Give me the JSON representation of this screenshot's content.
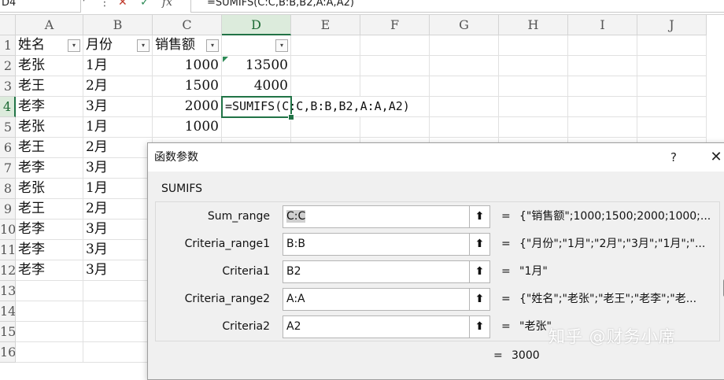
{
  "formula_bar": {
    "name_box": "D4",
    "name_box_arrow": "▾",
    "more_icon": "⋮",
    "cancel_icon": "✕",
    "enter_icon": "✓",
    "fx_label": "fx",
    "formula": "=SUMIFS(C:C,B:B,B2,A:A,A2)"
  },
  "grid": {
    "columns": [
      "A",
      "B",
      "C",
      "D",
      "E",
      "F",
      "G",
      "H",
      "I",
      "J"
    ],
    "rows": [
      "1",
      "2",
      "3",
      "4",
      "5",
      "6",
      "7",
      "8",
      "9",
      "10",
      "11",
      "12",
      "13",
      "14",
      "15",
      "16"
    ],
    "selected_column": "D",
    "selected_row": "4",
    "headers": [
      "姓名",
      "月份",
      "销售额",
      ""
    ],
    "filter_icon": "▾",
    "data": [
      [
        "老张",
        "1月",
        "1000",
        "13500"
      ],
      [
        "老王",
        "2月",
        "1500",
        "4000"
      ],
      [
        "老李",
        "3月",
        "2000",
        "=SUMIFS(C:C,B:B,B2,A:A,A2)"
      ],
      [
        "老张",
        "1月",
        "1000",
        ""
      ],
      [
        "老王",
        "2月",
        "",
        ""
      ],
      [
        "老李",
        "3月",
        "",
        ""
      ],
      [
        "老张",
        "1月",
        "",
        ""
      ],
      [
        "老王",
        "2月",
        "",
        ""
      ],
      [
        "老李",
        "3月",
        "",
        ""
      ],
      [
        "老李",
        "3月",
        "",
        ""
      ],
      [
        "老李",
        "3月",
        "",
        ""
      ]
    ]
  },
  "dialog": {
    "title": "函数参数",
    "help": "?",
    "close": "✕",
    "function_name": "SUMIFS",
    "collapse_icon": "⬆",
    "args": [
      {
        "label": "Sum_range",
        "value": "C:C",
        "result": "{\"销售额\";1000;1500;2000;1000;..."
      },
      {
        "label": "Criteria_range1",
        "value": "B:B",
        "result": "{\"月份\";\"1月\";\"2月\";\"3月\";\"1月\";\"..."
      },
      {
        "label": "Criteria1",
        "value": "B2",
        "result": "\"1月\""
      },
      {
        "label": "Criteria_range2",
        "value": "A:A",
        "result": "{\"姓名\";\"老张\";\"老王\";\"老李\";\"老..."
      },
      {
        "label": "Criteria2",
        "value": "A2",
        "result": "\"老张\""
      }
    ],
    "equals": "=",
    "result": "3000"
  },
  "watermark": "知乎 @财务小席",
  "colors": {
    "accent": "#217346",
    "header_bg": "#f3f3f3",
    "dialog_bg": "#f0f0f0"
  }
}
